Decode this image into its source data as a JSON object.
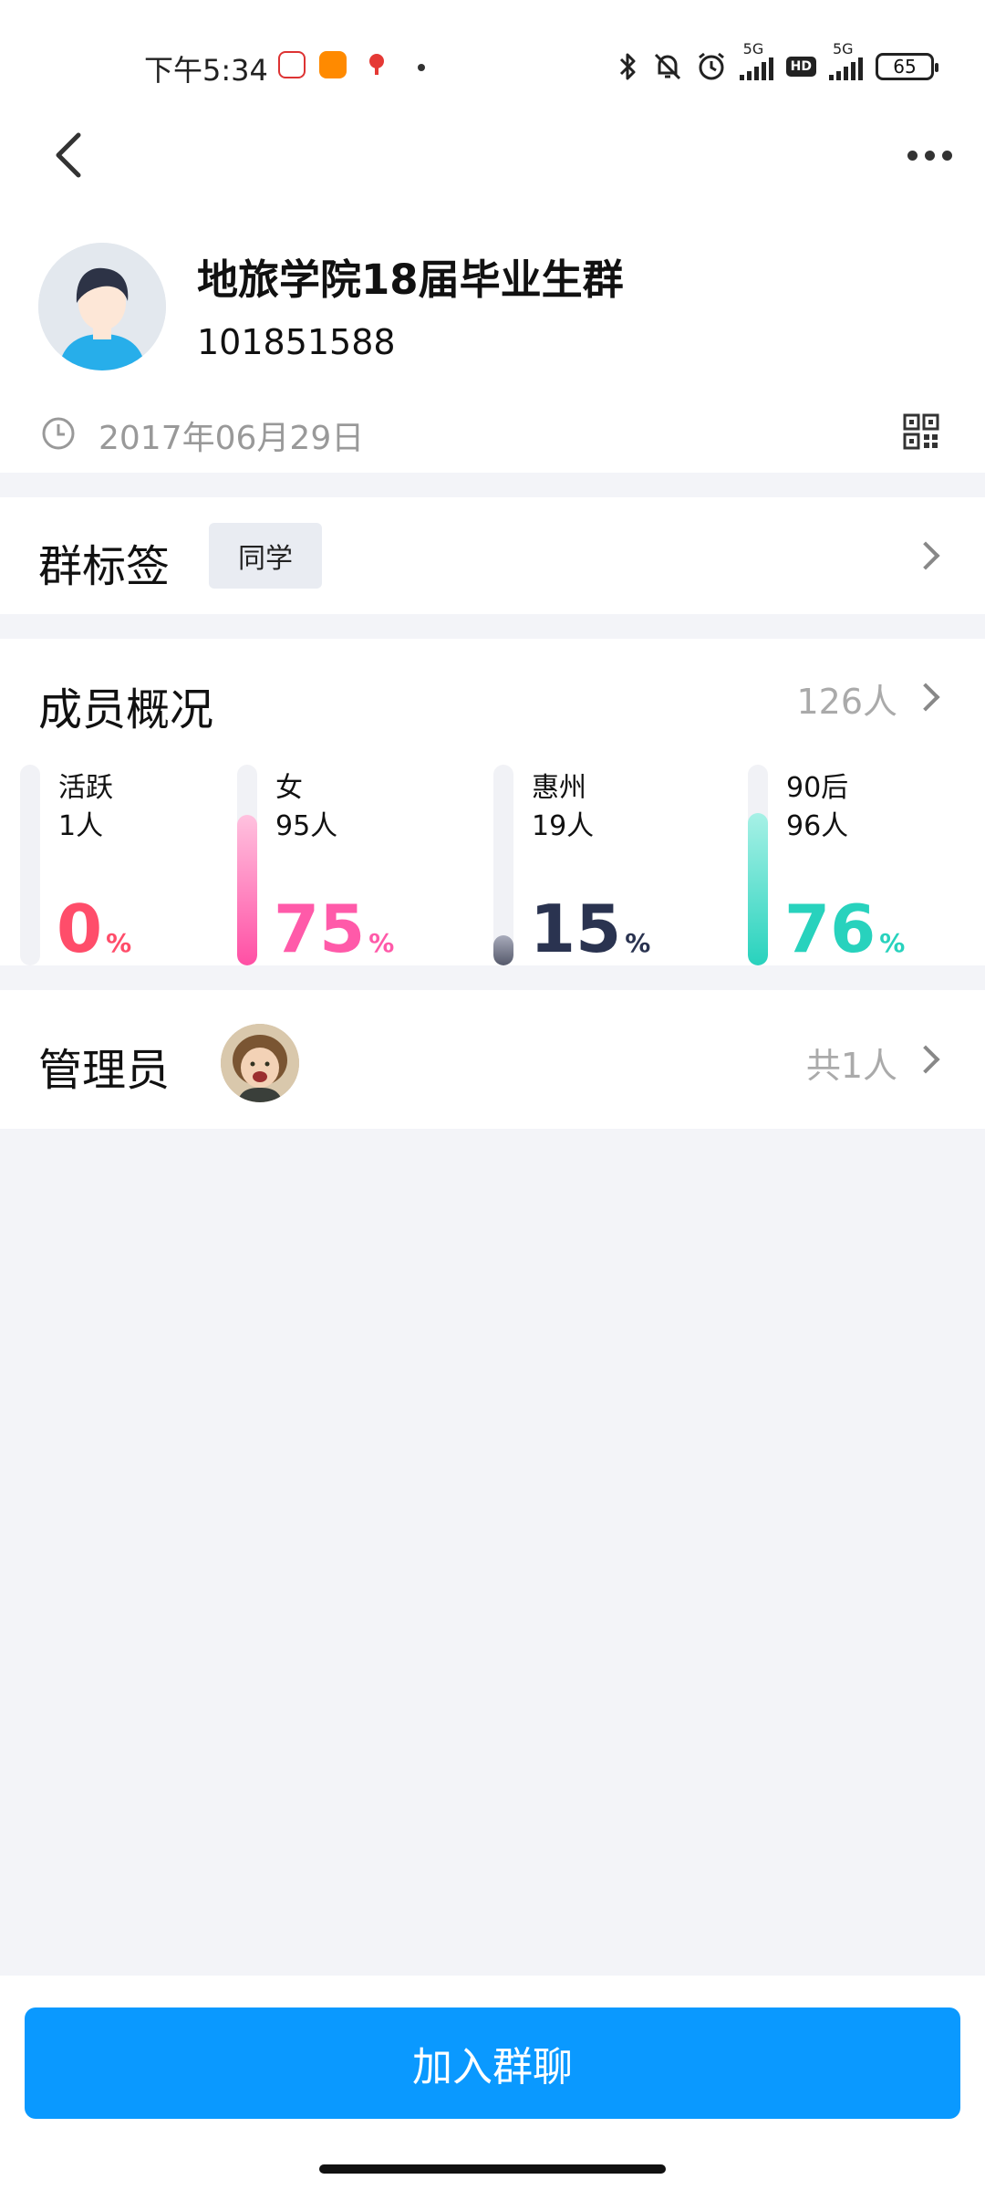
{
  "status_bar": {
    "time": "下午5:34",
    "network_1": "5G",
    "network_2": "5G",
    "hd": "HD",
    "battery": "65"
  },
  "header": {
    "group_name": "地旅学院18届毕业生群",
    "group_id": "101851588",
    "created_date": "2017年06月29日"
  },
  "tags": {
    "title": "群标签",
    "items": [
      "同学"
    ]
  },
  "members": {
    "title": "成员概况",
    "count": "126人",
    "stats": [
      {
        "label": "活跃",
        "count": "1人",
        "percent": "0",
        "unit": "%",
        "fraction": 0.0,
        "color": "#ff4d6a",
        "fill": ""
      },
      {
        "label": "女",
        "count": "95人",
        "percent": "75",
        "unit": "%",
        "fraction": 0.75,
        "color": "#ff5aa9",
        "fill": "linear-gradient(180deg,#ffc2df,#ff4fa4)"
      },
      {
        "label": "惠州",
        "count": "19人",
        "percent": "15",
        "unit": "%",
        "fraction": 0.15,
        "color": "#2a3350",
        "fill": "linear-gradient(180deg,#a8abbb,#55596b)"
      },
      {
        "label": "90后",
        "count": "96人",
        "percent": "76",
        "unit": "%",
        "fraction": 0.76,
        "color": "#28d2bd",
        "fill": "linear-gradient(180deg,#a7f1e6,#28d2bd)"
      }
    ]
  },
  "admins": {
    "title": "管理员",
    "count": "共1人"
  },
  "actions": {
    "join_label": "加入群聊"
  },
  "colors": {
    "primary": "#0a99ff",
    "background": "#f3f4f8"
  }
}
